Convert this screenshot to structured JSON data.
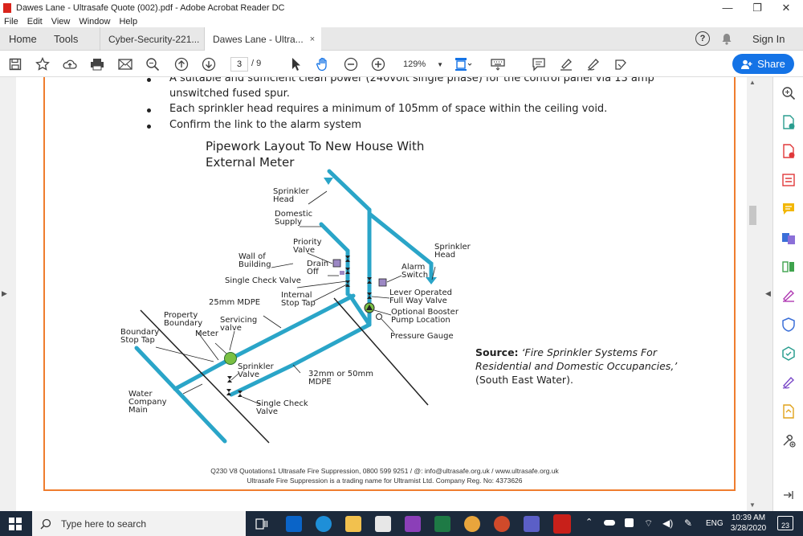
{
  "window": {
    "title": "Dawes Lane - Ultrasafe Quote (002).pdf - Adobe Acrobat Reader DC",
    "minimize_glyph": "—",
    "maximize_glyph": "❐",
    "close_glyph": "✕"
  },
  "menu": [
    "File",
    "Edit",
    "View",
    "Window",
    "Help"
  ],
  "tabs": {
    "home": "Home",
    "tools": "Tools",
    "doc1": "Cyber-Security-221...",
    "doc2": "Dawes Lane - Ultra...",
    "close_glyph": "×",
    "help_glyph": "?",
    "signin": "Sign In"
  },
  "toolbar": {
    "page_current": "3",
    "page_total": "/  9",
    "zoom": "129%",
    "share": "Share"
  },
  "document": {
    "bullet_partial": "A suitable and sufficient clean power (240volt single phase) for the control panel via 13 amp",
    "bullet_partial_cont": "unswitched fused spur.",
    "bullet2": "Each sprinkler head requires a minimum of 105mm of space within the ceiling void.",
    "bullet3": "Confirm the link to the alarm system",
    "diagram_title_1": "Pipework Layout To New House With",
    "diagram_title_2": "External Meter",
    "labels": {
      "sprinkler_head_1": "Sprinkler\nHead",
      "domestic_supply": "Domestic\nSupply",
      "priority_valve": "Priority\nValve",
      "wall_of_building": "Wall of\nBuilding",
      "drain_off": "Drain\nOff",
      "single_check_valve_1": "Single Check Valve",
      "internal_stop_tap": "Internal\nStop Tap",
      "mdpe_25": "25mm MDPE",
      "property_boundary": "Property\nBoundary",
      "servicing_valve": "Servicing\nvalve",
      "meter": "Meter",
      "boundary_stop_tap": "Boundary\nStop Tap",
      "sprinkler_head_2": "Sprinkler\nHead",
      "alarm_switch": "Alarm\nSwitch",
      "lever_operated": "Lever Operated\nFull Way Valve",
      "optional_booster": "Optional Booster\nPump Location",
      "pressure_gauge": "Pressure Gauge",
      "sprinkler_valve": "Sprinkler\nValve",
      "mdpe_32": "32mm or 50mm\nMDPE",
      "single_check_valve_2": "Single Check\nValve",
      "water_company_main": "Water\nCompany\nMain"
    },
    "source_label": "Source:",
    "source_title": "‘Fire Sprinkler Systems For Residential and Domestic Occupancies,’",
    "source_rest": "(South East Water).",
    "footer1": "Q230 V8 Quotations1  Ultrasafe Fire Suppression, 0800 599 9251 / @: info@ultrasafe.org.uk / www.ultrasafe.org.uk",
    "footer2": "Ultrasafe Fire Suppression is a trading name for Ultramist Ltd. Company Reg. No: 4373626"
  },
  "taskbar": {
    "search_placeholder": "Type here to search",
    "lang": "ENG",
    "time": "10:39 AM",
    "date": "3/28/2020",
    "notif": "23"
  },
  "colors": {
    "pipe": "#2aa5c8",
    "accent_orange": "#ef7d2e",
    "share_blue": "#1473e6",
    "taskbar": "#1c2a3c"
  }
}
